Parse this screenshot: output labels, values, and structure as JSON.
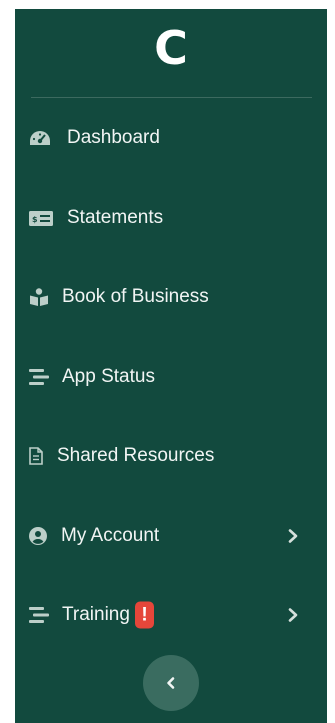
{
  "brand": {
    "logo_letter": "C"
  },
  "nav": {
    "items": [
      {
        "label": "Dashboard",
        "icon": "tachometer-icon"
      },
      {
        "label": "Statements",
        "icon": "money-bill-icon"
      },
      {
        "label": "Book of Business",
        "icon": "book-reader-icon"
      },
      {
        "label": "App Status",
        "icon": "stream-icon"
      },
      {
        "label": "Shared Resources",
        "icon": "file-icon"
      },
      {
        "label": "My Account",
        "icon": "user-circle-icon",
        "has_submenu": true
      },
      {
        "label": "Training",
        "icon": "stream-icon",
        "has_submenu": true,
        "alert": "!"
      }
    ]
  },
  "collapse": {
    "icon": "chevron-left-icon"
  },
  "colors": {
    "sidebar_bg": "#124a3e",
    "alert": "#e5463a",
    "collapse_bg": "#3a6c60"
  }
}
